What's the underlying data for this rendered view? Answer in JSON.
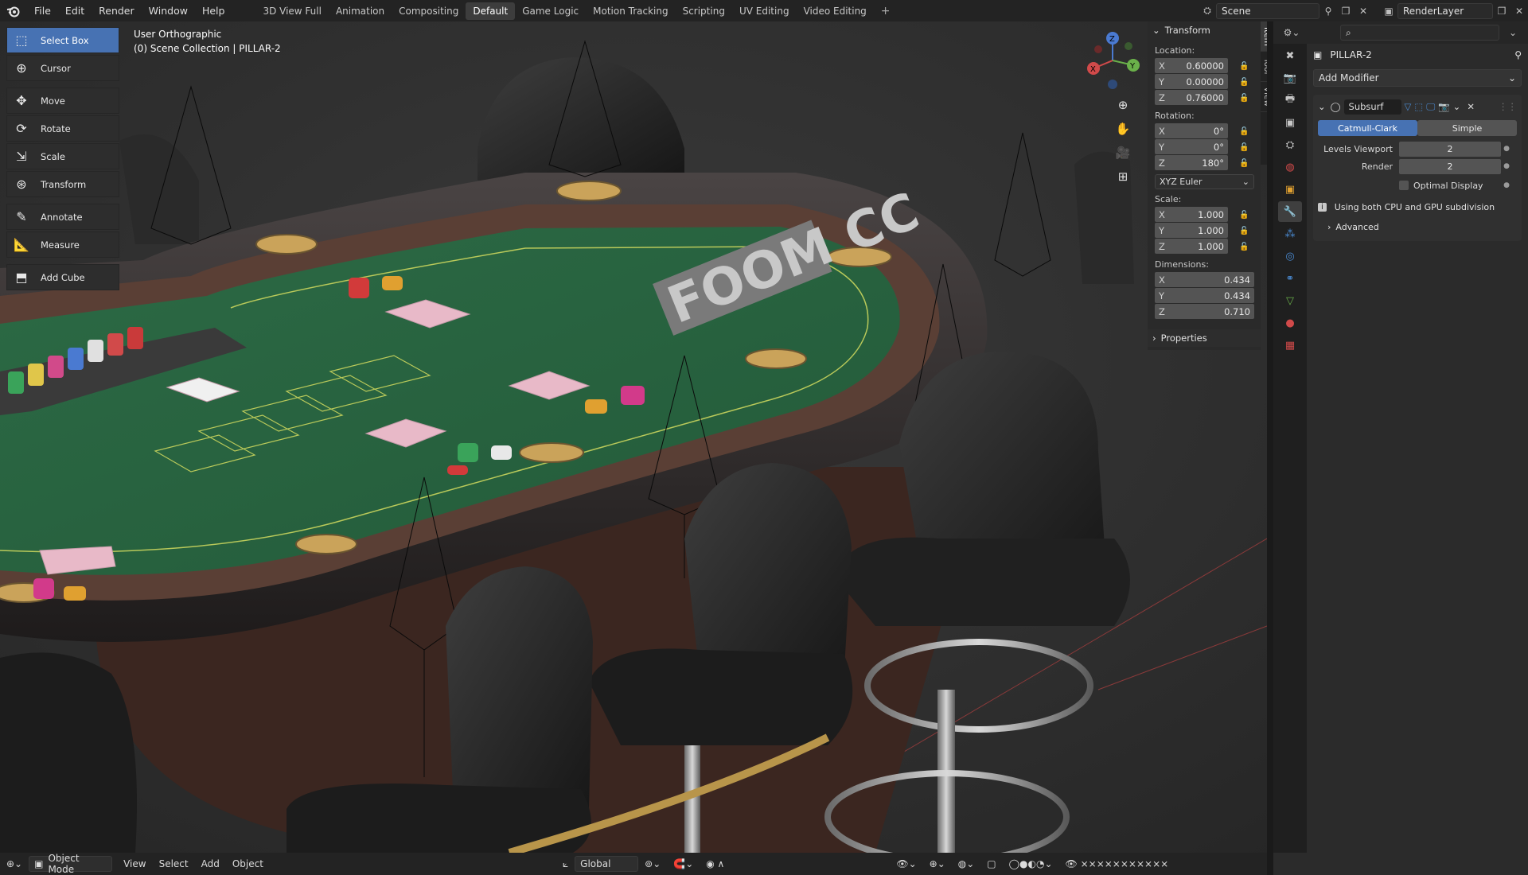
{
  "topbar": {
    "menus": [
      "File",
      "Edit",
      "Render",
      "Window",
      "Help"
    ],
    "workspaces": [
      "3D View Full",
      "Animation",
      "Compositing",
      "Default",
      "Game Logic",
      "Motion Tracking",
      "Scripting",
      "UV Editing",
      "Video Editing"
    ],
    "active_workspace": "Default",
    "add_workspace": "+",
    "scene_name": "Scene",
    "view_layer": "RenderLayer"
  },
  "toolbar": {
    "tools": [
      {
        "label": "Select Box",
        "icon": "select-box-icon",
        "active": true
      },
      {
        "label": "Cursor",
        "icon": "cursor-icon"
      },
      {
        "label": "Move",
        "icon": "move-icon"
      },
      {
        "label": "Rotate",
        "icon": "rotate-icon"
      },
      {
        "label": "Scale",
        "icon": "scale-icon"
      },
      {
        "label": "Transform",
        "icon": "transform-icon"
      },
      {
        "label": "Annotate",
        "icon": "annotate-icon"
      },
      {
        "label": "Measure",
        "icon": "measure-icon"
      },
      {
        "label": "Add Cube",
        "icon": "add-cube-icon"
      }
    ]
  },
  "viewport": {
    "view_name": "User Orthographic",
    "collection_path": "(0) Scene Collection | PILLAR-2",
    "table_text": "FOOM CC"
  },
  "gizmo": {
    "x": "X",
    "y": "Y",
    "z": "Z"
  },
  "npanel": {
    "header": "Transform",
    "location_label": "Location:",
    "location": [
      {
        "axis": "X",
        "value": "0.60000"
      },
      {
        "axis": "Y",
        "value": "0.00000"
      },
      {
        "axis": "Z",
        "value": "0.76000"
      }
    ],
    "rotation_label": "Rotation:",
    "rotation": [
      {
        "axis": "X",
        "value": "0°"
      },
      {
        "axis": "Y",
        "value": "0°"
      },
      {
        "axis": "Z",
        "value": "180°"
      }
    ],
    "rotation_mode": "XYZ Euler",
    "scale_label": "Scale:",
    "scale": [
      {
        "axis": "X",
        "value": "1.000"
      },
      {
        "axis": "Y",
        "value": "1.000"
      },
      {
        "axis": "Z",
        "value": "1.000"
      }
    ],
    "dimensions_label": "Dimensions:",
    "dimensions": [
      {
        "axis": "X",
        "value": "0.434"
      },
      {
        "axis": "Y",
        "value": "0.434"
      },
      {
        "axis": "Z",
        "value": "0.710"
      }
    ],
    "properties_label": "Properties",
    "tabs": [
      "Item",
      "Tool",
      "View"
    ]
  },
  "properties": {
    "object_name": "PILLAR-2",
    "add_modifier": "Add Modifier",
    "modifier_name": "Subsurf",
    "algorithms": [
      "Catmull-Clark",
      "Simple"
    ],
    "active_algorithm": "Catmull-Clark",
    "levels_viewport_label": "Levels Viewport",
    "levels_viewport": "2",
    "render_label": "Render",
    "render_levels": "2",
    "optimal_display": "Optimal Display",
    "gpu_info": "Using both CPU and GPU subdivision",
    "advanced": "Advanced"
  },
  "statusbar": {
    "mode": "Object Mode",
    "menus": [
      "View",
      "Select",
      "Add",
      "Object"
    ],
    "orientation": "Global"
  }
}
